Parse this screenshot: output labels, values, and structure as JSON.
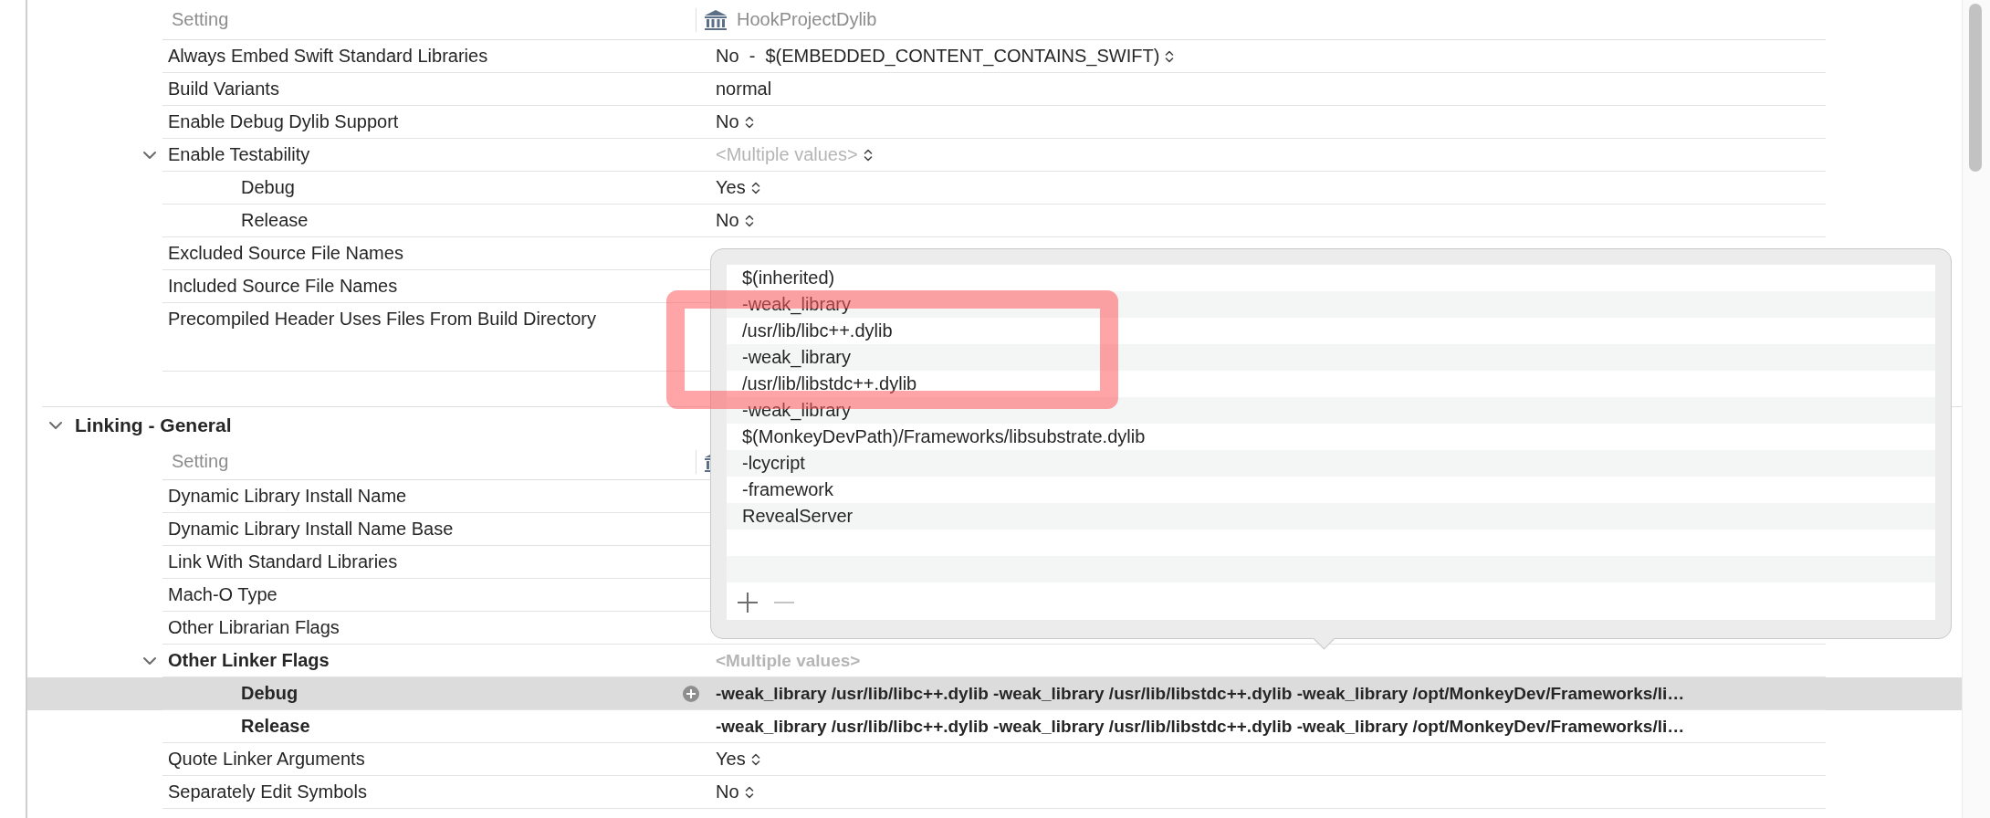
{
  "sections": [
    {
      "header": {
        "setting": "Setting",
        "target": "HookProjectDylib"
      },
      "rows": [
        {
          "name": "Always Embed Swift Standard Libraries",
          "value": "No  -  $(EMBEDDED_CONTENT_CONTAINS_SWIFT)",
          "kind": "popup",
          "selected": false
        },
        {
          "name": "Build Variants",
          "value": "normal",
          "kind": "text",
          "selected": false
        },
        {
          "name": "Enable Debug Dylib Support",
          "value": "No",
          "kind": "popup",
          "selected": false
        },
        {
          "name": "Enable Testability",
          "value": "<Multiple values>",
          "kind": "popup",
          "muted": true,
          "selected": false,
          "expanded": true,
          "children": [
            {
              "name": "Debug",
              "value": "Yes",
              "kind": "popup",
              "selected": false
            },
            {
              "name": "Release",
              "value": "No",
              "kind": "popup",
              "selected": false
            }
          ]
        },
        {
          "name": "Excluded Source File Names",
          "selected": false
        },
        {
          "name": "Included Source File Names",
          "selected": false
        },
        {
          "name": "Precompiled Header Uses Files From Build Directory",
          "tall": true,
          "selected": false
        }
      ]
    },
    {
      "title": "Linking - General",
      "expanded": true,
      "header": {
        "setting": "Setting"
      },
      "rows": [
        {
          "name": "Dynamic Library Install Name",
          "selected": false
        },
        {
          "name": "Dynamic Library Install Name Base",
          "selected": false
        },
        {
          "name": "Link With Standard Libraries",
          "selected": false
        },
        {
          "name": "Mach-O Type",
          "selected": false
        },
        {
          "name": "Other Librarian Flags",
          "selected": false
        },
        {
          "name": "Other Linker Flags",
          "value": "<Multiple values>",
          "kind": "text",
          "muted": true,
          "modified": true,
          "selected": false,
          "expanded": true,
          "children": [
            {
              "name": "Debug",
              "value": "-weak_library /usr/lib/libc++.dylib -weak_library /usr/lib/libstdc++.dylib -weak_library /opt/MonkeyDev/Frameworks/li…",
              "kind": "text",
              "modified": true,
              "selected": true
            },
            {
              "name": "Release",
              "value": "-weak_library /usr/lib/libc++.dylib -weak_library /usr/lib/libstdc++.dylib -weak_library /opt/MonkeyDev/Frameworks/li…",
              "kind": "text",
              "modified": true,
              "selected": false
            }
          ]
        },
        {
          "name": "Quote Linker Arguments",
          "value": "Yes",
          "kind": "popup",
          "selected": false
        },
        {
          "name": "Separately Edit Symbols",
          "value": "No",
          "kind": "popup",
          "selected": false
        }
      ]
    }
  ],
  "popup": {
    "items": [
      "$(inherited)",
      "-weak_library",
      "/usr/lib/libc++.dylib",
      "-weak_library",
      "/usr/lib/libstdc++.dylib",
      "-weak_library",
      "$(MonkeyDevPath)/Frameworks/libsubstrate.dylib",
      "-lcycript",
      "-framework",
      "RevealServer"
    ],
    "remove_disabled": true
  }
}
